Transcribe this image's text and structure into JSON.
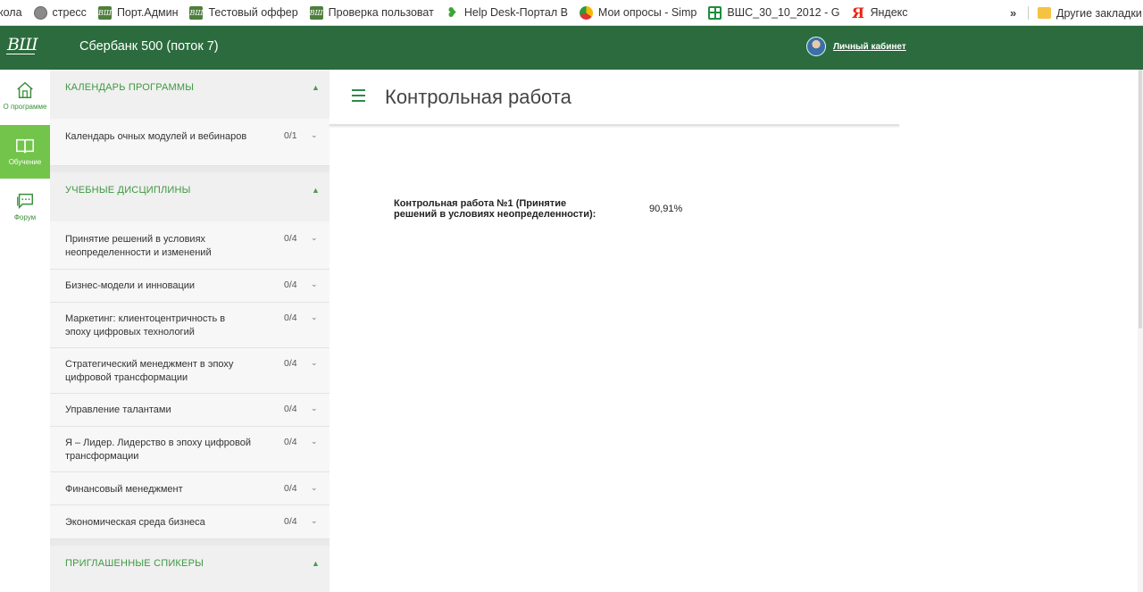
{
  "bookmarks": {
    "items": [
      {
        "label": "кола",
        "icon": "none"
      },
      {
        "label": "стресс",
        "icon": "globe-icon"
      },
      {
        "label": "Порт.Админ",
        "icon": "vshu-logo-icon"
      },
      {
        "label": "Тестовый оффер",
        "icon": "vshu-logo-icon"
      },
      {
        "label": "Проверка пользоват",
        "icon": "vshu-logo-icon"
      },
      {
        "label": "Help Desk-Портал В",
        "icon": "leaf-icon"
      },
      {
        "label": "Мои опросы - Simp",
        "icon": "pie-icon"
      },
      {
        "label": "ВШС_30_10_2012 - G",
        "icon": "sheet-icon"
      },
      {
        "label": "Яндекс",
        "icon": "yandex-icon"
      }
    ],
    "more": "»",
    "other": "Другие закладки"
  },
  "header": {
    "logo": "ВШ",
    "course": "Сбербанк 500 (поток 7)",
    "cabinet": "Личный кабинет"
  },
  "rail": {
    "items": [
      {
        "label": "О программе",
        "icon": "home-icon",
        "active": false
      },
      {
        "label": "Обучение",
        "icon": "book-icon",
        "active": true
      },
      {
        "label": "Форум",
        "icon": "chat-icon",
        "active": false
      }
    ]
  },
  "sidebar": {
    "calendar": {
      "title": "КАЛЕНДАРЬ ПРОГРАММЫ",
      "items": [
        {
          "label": "Календарь очных модулей и вебинаров",
          "count": "0/1"
        }
      ]
    },
    "disciplines": {
      "title": "УЧЕБНЫЕ ДИСЦИПЛИНЫ",
      "items": [
        {
          "label": "Принятие решений в условиях неопределенности и изменений",
          "count": "0/4"
        },
        {
          "label": "Бизнес-модели и инновации",
          "count": "0/4"
        },
        {
          "label": "Маркетинг: клиентоцентричность в эпоху цифровых технологий",
          "count": "0/4"
        },
        {
          "label": "Стратегический менеджмент в эпоху цифровой трансформации",
          "count": "0/4"
        },
        {
          "label": "Управление талантами",
          "count": "0/4"
        },
        {
          "label": "Я – Лидер. Лидерство в эпоху цифровой трансформации",
          "count": "0/4"
        },
        {
          "label": "Финансовый менеджмент",
          "count": "0/4"
        },
        {
          "label": "Экономическая среда бизнеса",
          "count": "0/4"
        }
      ]
    },
    "speakers": {
      "title": "ПРИГЛАШЕННЫЕ СПИКЕРЫ"
    }
  },
  "main": {
    "title": "Контрольная работа",
    "result_label": "Контрольная работа №1 (Принятие решений в условиях неопределенности):",
    "result_value": "90,91%"
  },
  "colors": {
    "header_bg": "#2b6b3d",
    "accent_green": "#3d9940",
    "active_rail": "#72c44a"
  }
}
